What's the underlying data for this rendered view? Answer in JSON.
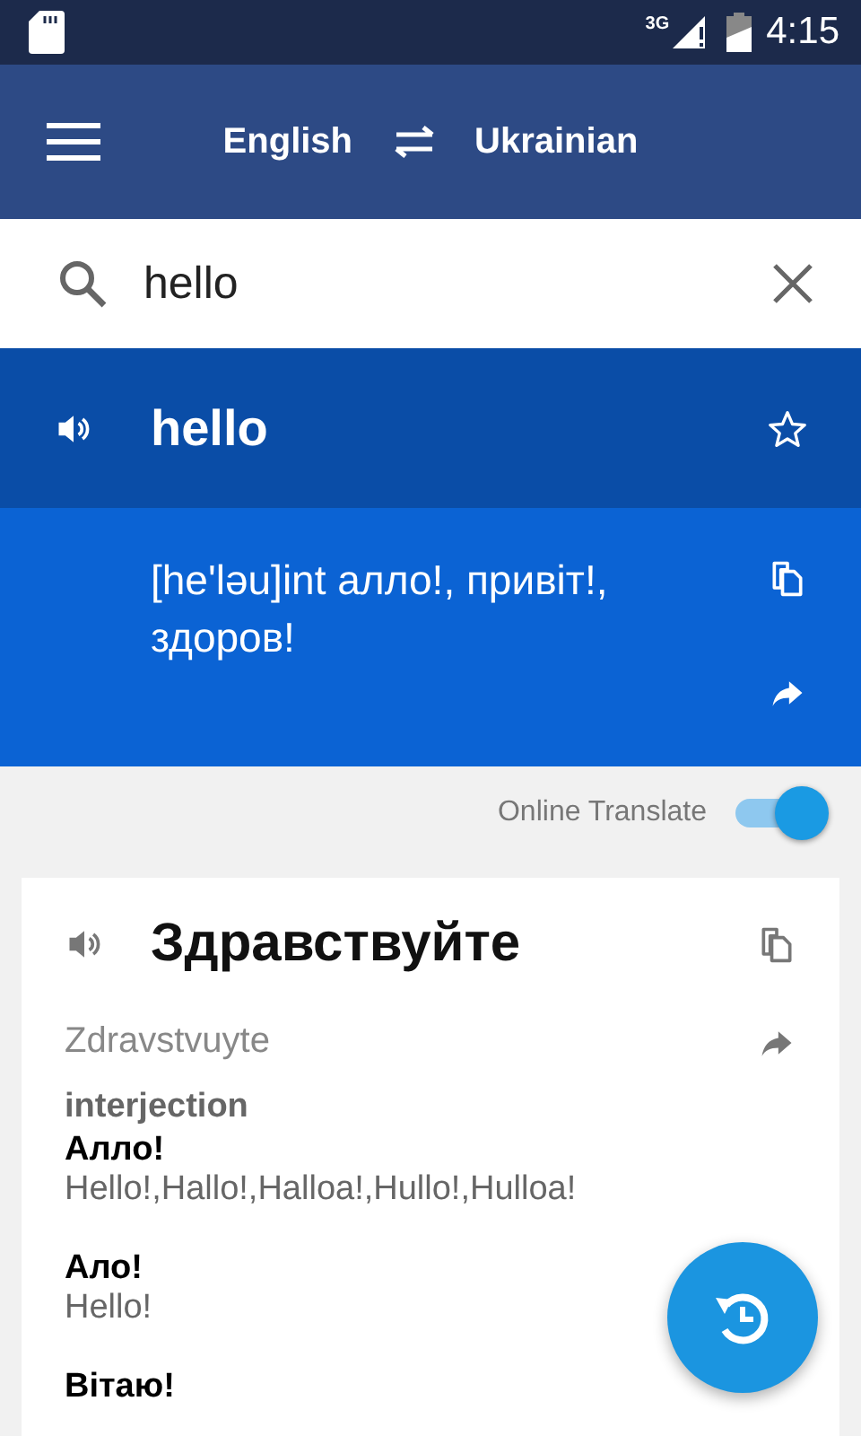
{
  "status_bar": {
    "network": "3G",
    "time": "4:15"
  },
  "app_bar": {
    "source_language": "English",
    "target_language": "Ukrainian"
  },
  "search": {
    "value": "hello"
  },
  "result": {
    "word": "hello",
    "favorite": false,
    "translation": "[he'ləu]int алло!, привіт!, здоров!"
  },
  "online_translate": {
    "label": "Online Translate",
    "on": true
  },
  "card": {
    "word": "Здравствуйте",
    "transliteration": "Zdravstvuyte",
    "part_of_speech": "interjection",
    "entries": [
      {
        "term": "Алло!",
        "meanings": "Hello!,Hallo!,Halloa!,Hullo!,Hulloa!"
      },
      {
        "term": "Ало!",
        "meanings": "Hello!"
      },
      {
        "term": "Вітаю!"
      }
    ]
  }
}
